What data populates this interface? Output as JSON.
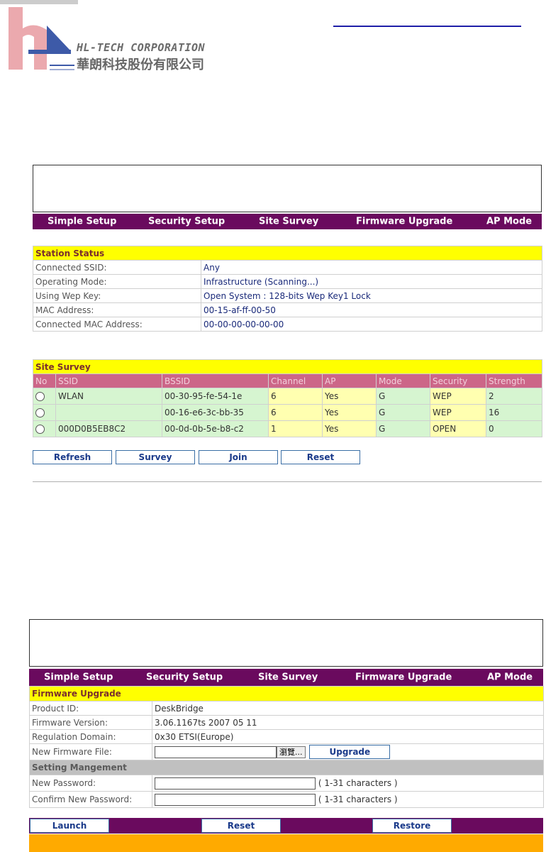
{
  "logo": {
    "company_en": "HL-TECH CORPORATION",
    "company_zh": "華朗科技股份有限公司",
    "icon": "hl-tech-logo"
  },
  "nav": {
    "items": [
      "Simple Setup",
      "Security Setup",
      "Site Survey",
      "Firmware Upgrade",
      "AP Mode"
    ]
  },
  "station_status": {
    "title": "Station Status",
    "rows": [
      {
        "label": "Connected SSID:",
        "value": "Any"
      },
      {
        "label": "Operating Mode:",
        "value": "Infrastructure (Scanning...)"
      },
      {
        "label": "Using Wep Key:",
        "value": "Open System : 128-bits Wep Key1 Lock"
      },
      {
        "label": "MAC Address:",
        "value": "00-15-af-ff-00-50"
      },
      {
        "label": "Connected MAC Address:",
        "value": "00-00-00-00-00-00"
      }
    ]
  },
  "site_survey": {
    "title": "Site Survey",
    "columns": [
      "No",
      "SSID",
      "BSSID",
      "Channel",
      "AP",
      "Mode",
      "Security",
      "Strength"
    ],
    "rows": [
      {
        "ssid": "WLAN",
        "bssid": "00-30-95-fe-54-1e",
        "channel": "6",
        "ap": "Yes",
        "mode": "G",
        "security": "WEP",
        "strength": "2"
      },
      {
        "ssid": "",
        "bssid": "00-16-e6-3c-bb-35",
        "channel": "6",
        "ap": "Yes",
        "mode": "G",
        "security": "WEP",
        "strength": "16"
      },
      {
        "ssid": "000D0B5EB8C2",
        "bssid": "00-0d-0b-5e-b8-c2",
        "channel": "1",
        "ap": "Yes",
        "mode": "G",
        "security": "OPEN",
        "strength": "0"
      }
    ],
    "buttons": {
      "refresh": "Refresh",
      "survey": "Survey",
      "join": "Join",
      "reset": "Reset"
    }
  },
  "firmware": {
    "title": "Firmware Upgrade",
    "rows": [
      {
        "label": "Product ID:",
        "value": "DeskBridge"
      },
      {
        "label": "Firmware Version:",
        "value": "3.06.1167ts 2007 05 11"
      },
      {
        "label": "Regulation Domain:",
        "value": "0x30 ETSI(Europe)"
      }
    ],
    "file_label": "New Firmware File:",
    "browse_label": "瀏覽...",
    "upgrade_label": "Upgrade",
    "setting_title": "Setting Mangement",
    "new_password_label": "New Password:",
    "confirm_password_label": "Confirm New Password:",
    "chars_hint": "( 1-31 characters )",
    "buttons": {
      "launch": "Launch",
      "reset": "Reset",
      "restore": "Restore"
    }
  }
}
